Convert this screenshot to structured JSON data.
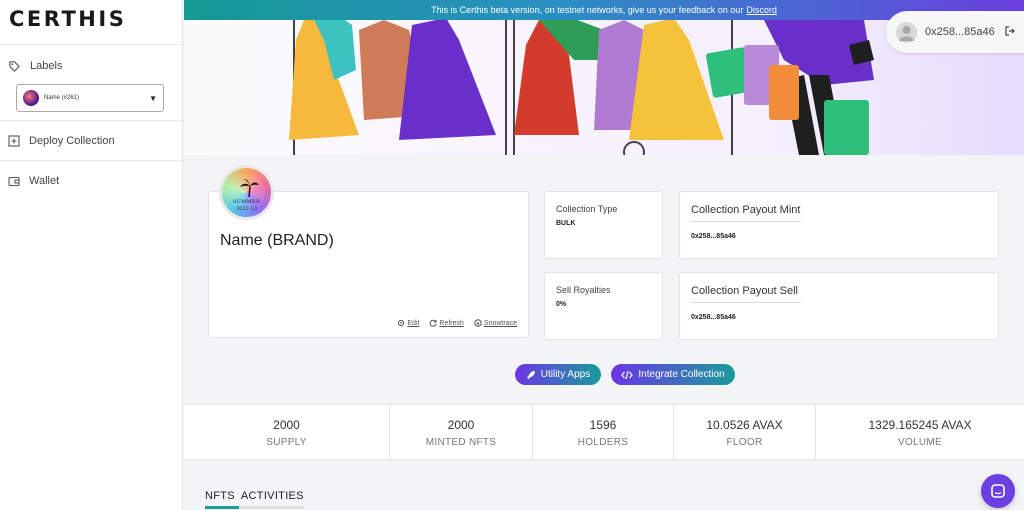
{
  "app": {
    "logo": "CERTHIS"
  },
  "sidebar": {
    "labels_title": "Labels",
    "label_select_value": "Name (#261)",
    "deploy_collection": "Deploy Collection",
    "wallet": "Wallet"
  },
  "banner": {
    "beta_text": "This is Certhis beta version, on testnet networks, give us your feedback on our",
    "beta_link": "Discord"
  },
  "wallet_chip": {
    "address": "0x258...85a46"
  },
  "brand": {
    "name": "Name (BRAND)",
    "avatar_text": "SUMMER",
    "avatar_year": "2022-23",
    "actions": {
      "edit": "Edit",
      "refresh": "Refresh",
      "snowtrace": "Snowtrace"
    }
  },
  "collection_type": {
    "label": "Collection Type",
    "value": "BULK"
  },
  "sell_royalties": {
    "label": "Sell Royalties",
    "value": "0%"
  },
  "payout_mint": {
    "label": "Collection Payout Mint",
    "value": "0x258...85a46"
  },
  "payout_sell": {
    "label": "Collection Payout Sell",
    "value": "0x258...85a46"
  },
  "buttons": {
    "utility_apps": "Utility Apps",
    "integrate_collection": "Integrate Collection"
  },
  "stats": [
    {
      "value": "2000",
      "caption": "SUPPLY"
    },
    {
      "value": "2000",
      "caption": "MINTED NFTS"
    },
    {
      "value": "1596",
      "caption": "HOLDERS"
    },
    {
      "value": "10.0526 AVAX",
      "caption": "FLOOR"
    },
    {
      "value": "1329.165245 AVAX",
      "caption": "VOLUME"
    }
  ],
  "tabs": {
    "nfts": "NFTS",
    "activities": "ACTIVITIES"
  },
  "colors": {
    "accent_purple": "#6c35e8",
    "accent_teal": "#1a9b9b"
  }
}
